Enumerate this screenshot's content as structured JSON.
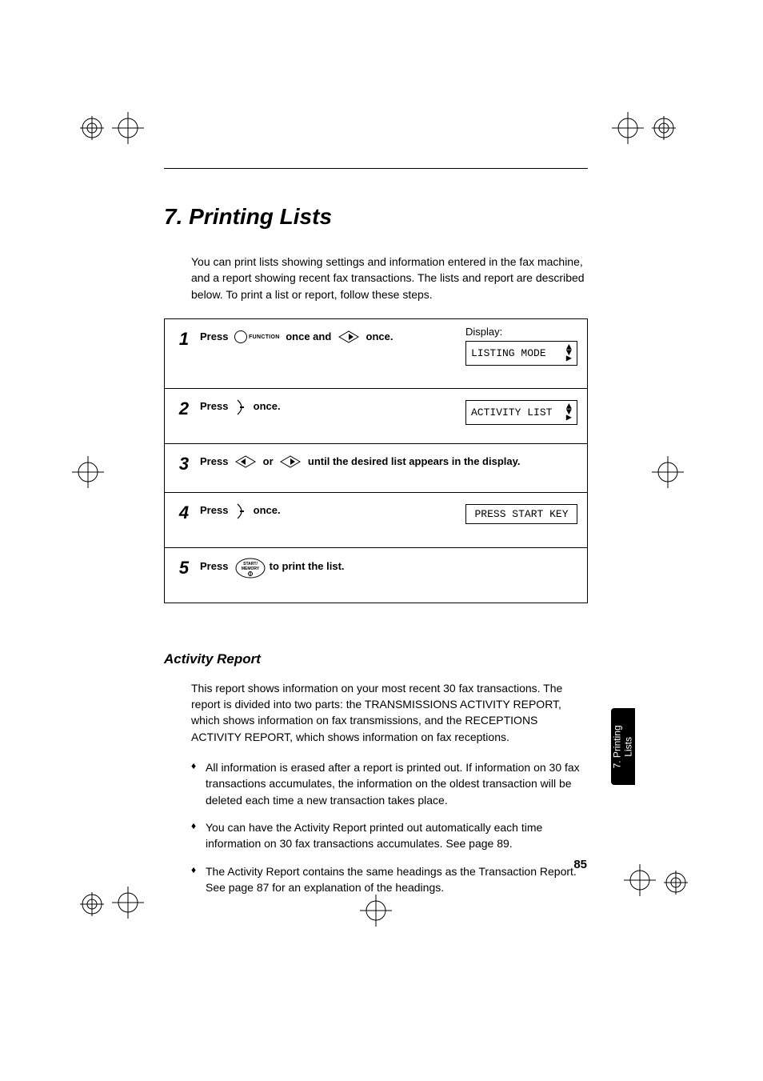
{
  "chapter": {
    "title": "7.  Printing Lists"
  },
  "intro": "You can print lists showing settings and information entered in the fax machine, and a report showing recent fax transactions. The lists and report are described below. To print a list or report, follow these steps.",
  "steps": [
    {
      "num": "1",
      "pre": "Press ",
      "mid": " once and ",
      "post": " once.",
      "display_label": "Display:",
      "display_value": "LISTING MODE"
    },
    {
      "num": "2",
      "pre": "Press ",
      "post": " once.",
      "display_value": "ACTIVITY LIST"
    },
    {
      "num": "3",
      "pre": "Press ",
      "mid": " or ",
      "post": " until the desired list appears in the display."
    },
    {
      "num": "4",
      "pre": "Press ",
      "post": " once.",
      "display_value": "PRESS START KEY"
    },
    {
      "num": "5",
      "pre": "Press ",
      "post": " to print the list."
    }
  ],
  "icons": {
    "function_label": "FUNCTION",
    "start_label_top": "START/",
    "start_label_mid": "MEMORY"
  },
  "activity": {
    "title": "Activity Report",
    "para": "This report shows information on your most recent 30 fax transactions. The report is divided into two parts: the TRANSMISSIONS ACTIVITY REPORT, which shows information on fax transmissions, and the RECEPTIONS ACTIVITY REPORT, which shows information on fax receptions.",
    "bullets": [
      "All information is erased after a report is printed out. If information on 30 fax transactions accumulates, the information on the oldest transaction will be deleted each time a new transaction takes place.",
      "You can have the Activity Report printed out automatically each time information on 30 fax transactions accumulates. See page 89.",
      "The Activity Report contains the same headings as the Transaction Report. See page 87 for an explanation of the headings."
    ]
  },
  "side_tab": "7. Printing\nLists",
  "page_number": "85"
}
